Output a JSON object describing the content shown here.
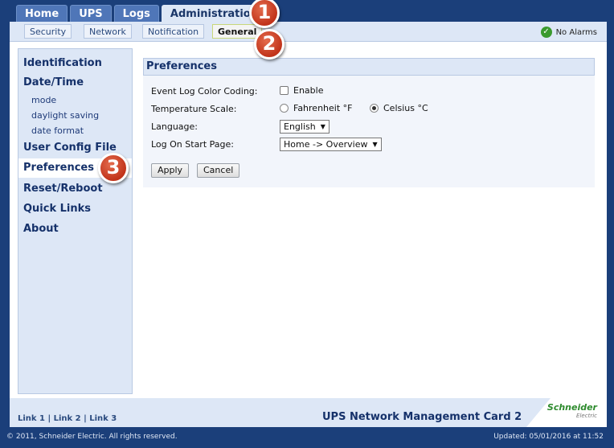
{
  "top_tabs": [
    "Home",
    "UPS",
    "Logs",
    "Administration"
  ],
  "sub_tabs": [
    "Security",
    "Network",
    "Notification",
    "General"
  ],
  "alarm_status": "No Alarms",
  "sidebar": {
    "identification": "Identification",
    "datetime": "Date/Time",
    "mode": "mode",
    "daylight": "daylight saving",
    "date_format": "date format",
    "user_config": "User Config File",
    "preferences": "Preferences",
    "reset": "Reset/Reboot",
    "quick_links": "Quick Links",
    "about": "About"
  },
  "section_title": "Preferences",
  "form": {
    "event_log_label": "Event Log Color Coding:",
    "event_log_option": "Enable",
    "event_log_checked": false,
    "temp_label": "Temperature Scale:",
    "temp_f": "Fahrenheit °F",
    "temp_c": "Celsius °C",
    "temp_selected": "Celsius °C",
    "language_label": "Language:",
    "language_value": "English",
    "start_page_label": "Log On Start Page:",
    "start_page_value": "Home -> Overview",
    "apply": "Apply",
    "cancel": "Cancel"
  },
  "footer": {
    "links": "Link 1 | Link 2 | Link 3",
    "title": "UPS Network Management Card 2",
    "brand": "Schneider",
    "brand_sub": "Electric",
    "copyright": "© 2011, Schneider Electric. All rights reserved.",
    "updated": "Updated: 05/01/2016 at 11:52"
  },
  "markers": [
    "1",
    "2",
    "3"
  ],
  "colors": {
    "page_bg": "#1b3f7a",
    "panel": "#dde7f6",
    "marker": "#c1331a",
    "ok": "#3a9a2e"
  }
}
